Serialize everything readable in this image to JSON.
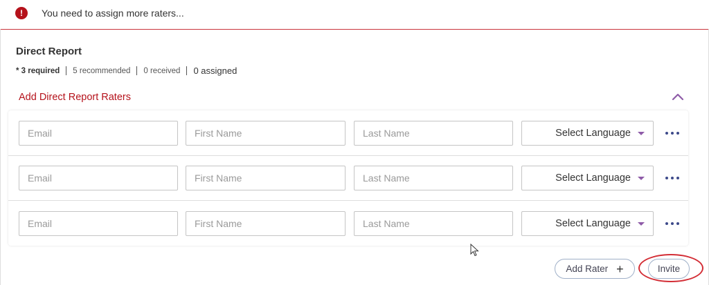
{
  "alert": {
    "icon": "info-icon",
    "glyph": "!",
    "message": "You need to assign more raters..."
  },
  "section": {
    "title": "Direct Report",
    "required": "* 3 required",
    "recommended": "5 recommended",
    "received": "0 received",
    "assigned": "0 assigned"
  },
  "add_panel": {
    "title": "Add Direct Report Raters",
    "collapse_icon": "chevron-up-icon"
  },
  "rows": [
    {
      "email_placeholder": "Email",
      "first_placeholder": "First Name",
      "last_placeholder": "Last Name",
      "language": "Select Language"
    },
    {
      "email_placeholder": "Email",
      "first_placeholder": "First Name",
      "last_placeholder": "Last Name",
      "language": "Select Language"
    },
    {
      "email_placeholder": "Email",
      "first_placeholder": "First Name",
      "last_placeholder": "Last Name",
      "language": "Select Language"
    }
  ],
  "buttons": {
    "add_rater": "Add Rater",
    "add_rater_icon": "plus-icon",
    "invite": "Invite"
  },
  "colors": {
    "alert_red": "#b5121b",
    "accent_purple": "#8e5ba8",
    "more_dots": "#3d4a8a",
    "highlight_ring": "#d32d35"
  }
}
